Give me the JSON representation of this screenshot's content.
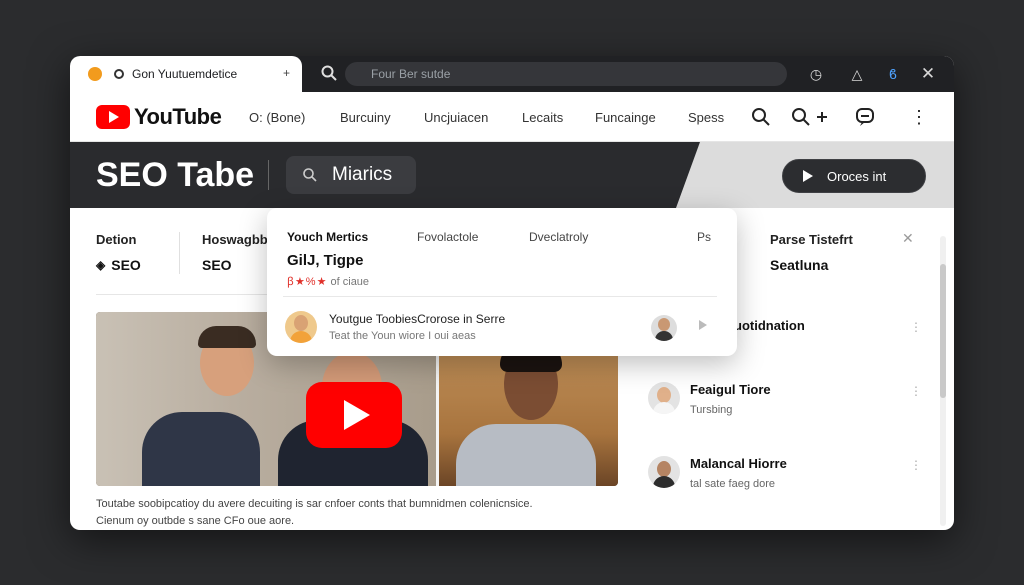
{
  "browser": {
    "tab_title": "Gon Yuutuemdetice",
    "tab_close": "+",
    "address_placeholder": "Four Ber sutde"
  },
  "youtube": {
    "logo_text": "YouTube",
    "nav": [
      "O: (Bone)",
      "Burcuiny",
      "Uncjuiacen",
      "Lecaits",
      "Funcainge",
      "Spess"
    ],
    "nav_icons": [
      "search-icon",
      "search-add-icon",
      "chat-icon",
      "more-vertical-icon"
    ]
  },
  "banner": {
    "title": "SEO Tabe",
    "search_text": "Miarics",
    "process_button": "Oroces int"
  },
  "stats": [
    {
      "label": "Detion",
      "value": "SEO",
      "icon": "diamond-icon"
    },
    {
      "label": "Hoswagbb",
      "value": "SEO"
    },
    {
      "label": "Parse Tistefrt",
      "value": "Seatluna"
    }
  ],
  "popup": {
    "tabs": [
      "Youch Mertics",
      "Fovolactole",
      "Dveclatroly",
      "Ps"
    ],
    "headline": "GilJ, Tigpe",
    "rating_stars": "ꞵ★%★",
    "rating_text": "of ciaue",
    "row_title": "Youtgue ToobiesCrorose in Serre",
    "row_sub": "Teat the Youn wiore I oui aeas"
  },
  "video": {
    "description_line1": "Toutabe soobipcatioy du avere decuiting is sar cnfoer conts that bumnidmen colenicnsice.",
    "description_line2": "Cienum oy outbde s sane CFo oue aore."
  },
  "sidebar_list": [
    {
      "title": "uotidnation",
      "sub": ""
    },
    {
      "title": "Feaigul Tiore",
      "sub": "Tursbing"
    },
    {
      "title": "Malancal Hiorre",
      "sub": "tal sate faeg dore"
    }
  ],
  "colors": {
    "brand_red": "#ff0000",
    "page_bg": "#2b2c2e",
    "banner_bg": "#2a2b2e",
    "tab_dot": "#f29b1d"
  }
}
